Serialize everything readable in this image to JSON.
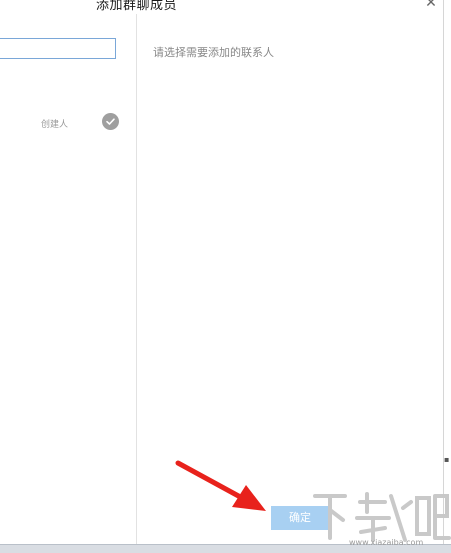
{
  "dialog": {
    "title": "添加群聊成员",
    "close_icon": "close-icon"
  },
  "left_panel": {
    "search": {
      "value": "",
      "placeholder": ""
    },
    "members": [
      {
        "role_label": "创建人",
        "status_icon": "check-circle-icon",
        "selected": true
      }
    ]
  },
  "right_panel": {
    "hint": "请选择需要添加的联系人"
  },
  "footer": {
    "confirm_label": "确定",
    "confirm_enabled": false
  },
  "annotation": {
    "arrow_color": "#e8221c",
    "points_to": "confirm-button"
  },
  "watermark": {
    "logo_text": "下载吧",
    "url": "www.xiazaiba.com"
  },
  "colors": {
    "confirm_button_disabled": "#a8d0f2",
    "check_icon": "#9f9f9f",
    "search_border": "#7aa7d8"
  }
}
